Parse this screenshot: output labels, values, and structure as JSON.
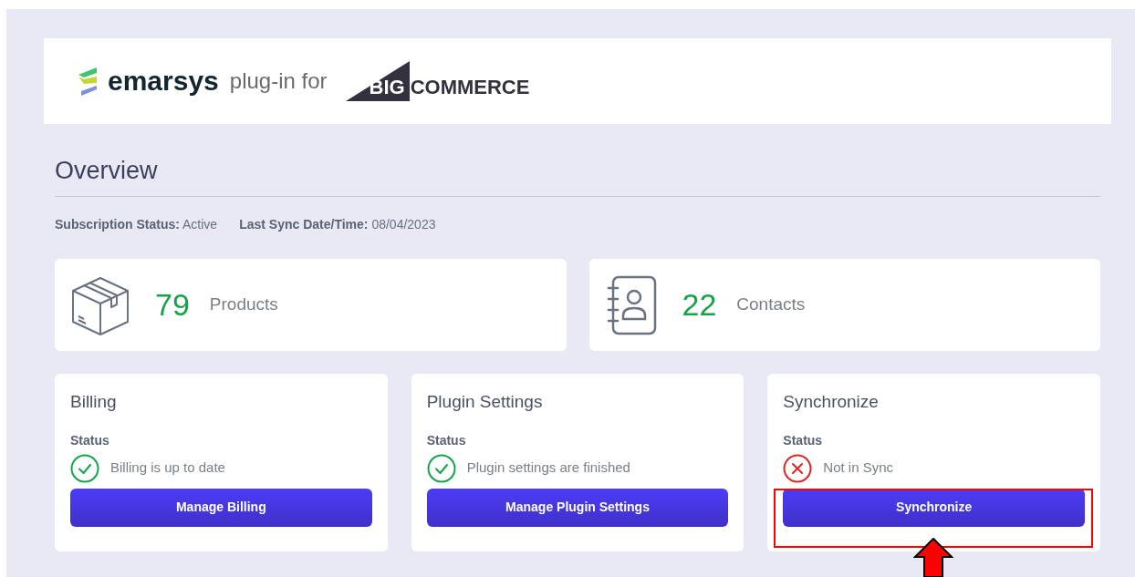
{
  "header": {
    "brand": "emarsys",
    "tagline": "plug-in for",
    "partner_mark": "BIG",
    "partner_name": "COMMERCE"
  },
  "overview": {
    "title": "Overview",
    "meta": [
      {
        "label": "Subscription Status:",
        "value": "Active"
      },
      {
        "label": "Last Sync Date/Time:",
        "value": "08/04/2023"
      }
    ]
  },
  "stats": [
    {
      "kind": "box",
      "count": "79",
      "label": "Products"
    },
    {
      "kind": "contacts",
      "count": "22",
      "label": "Contacts"
    }
  ],
  "cards": [
    {
      "title": "Billing",
      "status_label": "Status",
      "kind": "ok",
      "status_text": "Billing is up to date",
      "button": "Manage Billing",
      "highlighted": false
    },
    {
      "title": "Plugin Settings",
      "status_label": "Status",
      "kind": "ok",
      "status_text": "Plugin settings are finished",
      "button": "Manage Plugin Settings",
      "highlighted": false
    },
    {
      "title": "Synchronize",
      "status_label": "Status",
      "kind": "error",
      "status_text": "Not in Sync",
      "button": "Synchronize",
      "highlighted": true
    }
  ]
}
